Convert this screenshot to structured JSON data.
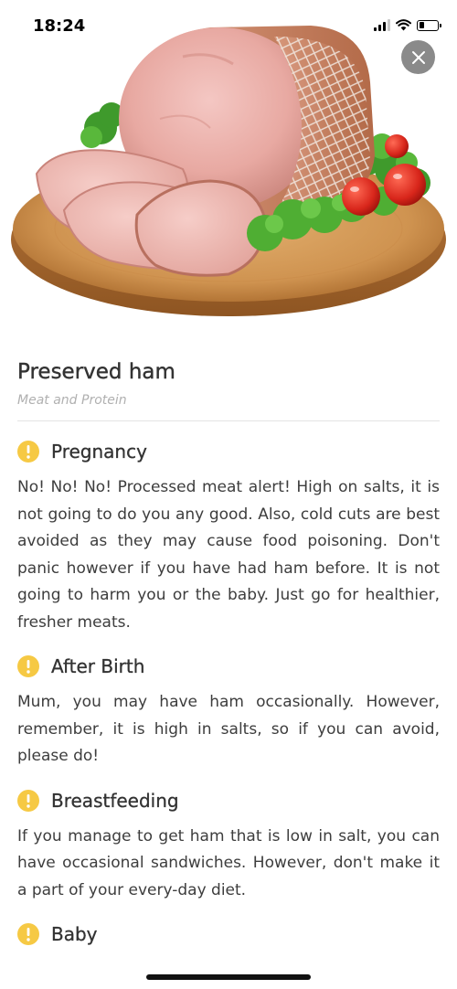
{
  "status": {
    "time": "18:24",
    "signal_bars_active": 3,
    "signal_bars_total": 4,
    "battery_level": 0.3
  },
  "close_icon": "close-icon",
  "hero": {
    "icon": "ham-image"
  },
  "food": {
    "title": "Preserved ham",
    "category": "Meat and Protein"
  },
  "sections": [
    {
      "icon": "exclamation-icon",
      "title": "Pregnancy",
      "body": "No! No! No! Processed meat alert! High on salts, it is not going to do you any good. Also, cold cuts are best avoided as they may cause food poisoning. Don't panic however if you have had ham before. It is not going to harm you or the baby. Just go for healthier, fresher meats."
    },
    {
      "icon": "exclamation-icon",
      "title": "After Birth",
      "body": "Mum, you may have ham occasionally. However, remember, it is high in salts, so if you can avoid, please do!"
    },
    {
      "icon": "exclamation-icon",
      "title": "Breastfeeding",
      "body": "If you manage to get ham that is low in salt, you can have occasional sandwiches. However, don't make it a part of your every-day diet."
    },
    {
      "icon": "exclamation-icon",
      "title": "Baby",
      "body": ""
    }
  ],
  "colors": {
    "warning": "#f6c944",
    "close_bg": "#8a8a8a",
    "category": "#b0b0b0"
  }
}
